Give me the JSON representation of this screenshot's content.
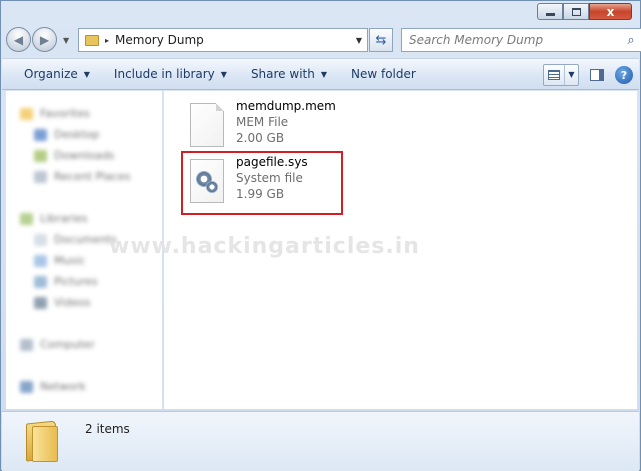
{
  "window": {
    "close_glyph": "x"
  },
  "navbar": {
    "back_glyph": "◀",
    "forward_glyph": "▶",
    "address_separator": "▸",
    "address_text": "Memory Dump",
    "refresh_glyph": "⇆",
    "search_placeholder": "Search Memory Dump",
    "search_glyph": "⌕"
  },
  "toolbar": {
    "organize": "Organize",
    "include_in_library": "Include in library",
    "share_with": "Share with",
    "new_folder": "New folder",
    "dropdown_glyph": "▼",
    "help_glyph": "?"
  },
  "navpane": {
    "favorites": "Favorites",
    "desktop": "Desktop",
    "downloads": "Downloads",
    "recent_places": "Recent Places",
    "libraries": "Libraries",
    "documents": "Documents",
    "music": "Music",
    "pictures": "Pictures",
    "videos": "Videos",
    "computer": "Computer",
    "network": "Network"
  },
  "files": [
    {
      "name": "memdump.mem",
      "type": "MEM File",
      "size": "2.00 GB"
    },
    {
      "name": "pagefile.sys",
      "type": "System file",
      "size": "1.99 GB"
    }
  ],
  "watermark": "www.hackingarticles.in",
  "status": {
    "item_count": "2 items"
  },
  "colors": {
    "highlight_border": "#d21f25",
    "command_text": "#1e3b66"
  },
  "icons": {
    "back": "arrow-left-icon",
    "forward": "arrow-right-icon",
    "folder": "folder-icon",
    "refresh": "refresh-icon",
    "search": "search-icon",
    "view": "view-options-icon",
    "preview_pane": "preview-pane-icon",
    "help": "help-icon",
    "memdump": "blank-document-icon",
    "pagefile": "system-file-gear-icon"
  }
}
